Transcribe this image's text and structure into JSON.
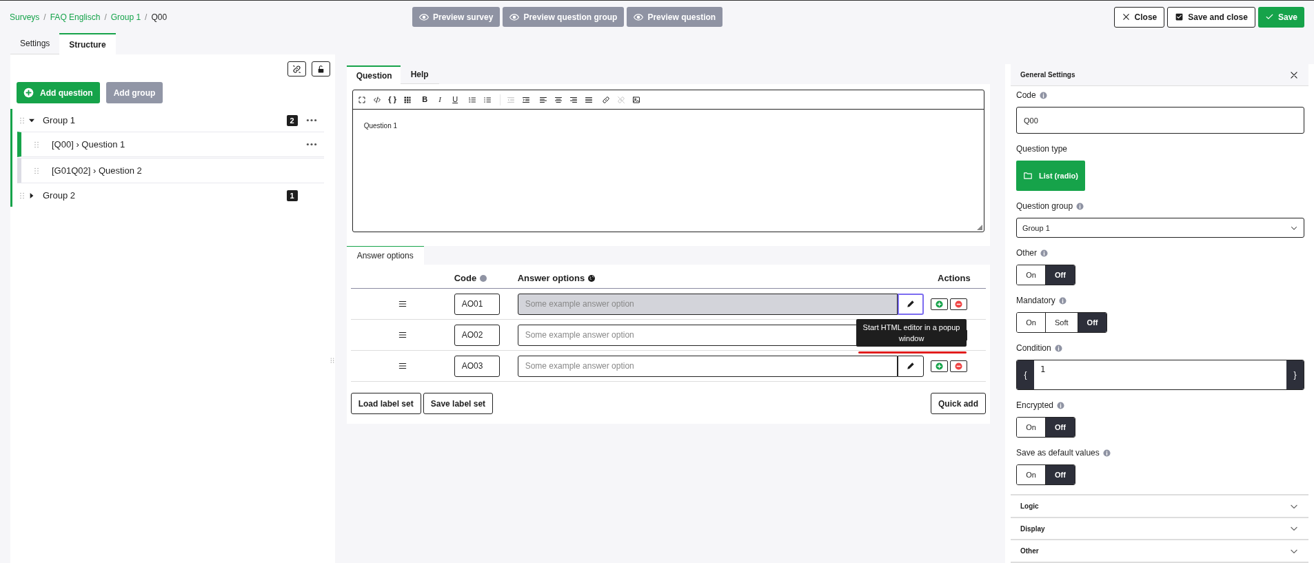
{
  "breadcrumbs": {
    "separator": "/",
    "items": [
      {
        "label": "Surveys",
        "kind": "link"
      },
      {
        "label": "FAQ Englisch",
        "kind": "link"
      },
      {
        "label": "Group 1",
        "kind": "link"
      },
      {
        "label": "Q00",
        "kind": "current"
      }
    ]
  },
  "preview_buttons": [
    "Preview survey",
    "Preview question group",
    "Preview question"
  ],
  "actions": [
    {
      "label": "Close",
      "kind": "close"
    },
    {
      "label": "Save and close",
      "kind": "save_close"
    },
    {
      "label": "Save",
      "kind": "save"
    }
  ],
  "page_tabs": [
    {
      "label": "Settings",
      "selected": false
    },
    {
      "label": "Structure",
      "selected": true
    }
  ],
  "structure": {
    "add_question": "Add question",
    "add_group": "Add group",
    "groups": [
      {
        "title": "Group 1",
        "count": "2",
        "expanded": true,
        "menu": true,
        "children": [
          {
            "label": "[Q00] › Question 1",
            "selected": true,
            "menu": true
          },
          {
            "label": "[G01Q02] › Question 2",
            "selected": false,
            "menu": false
          }
        ]
      },
      {
        "title": "Group 2",
        "count": "1",
        "expanded": false,
        "menu": false
      }
    ]
  },
  "editor": {
    "tabs": [
      {
        "label": "Question",
        "selected": true
      },
      {
        "label": "Help",
        "selected": false
      }
    ],
    "toolbar": [
      [
        {
          "kind": "fullscreen",
          "disabled": false
        },
        {
          "kind": "code",
          "disabled": false
        },
        {
          "kind": "braces",
          "label": "{ }",
          "disabled": false
        },
        {
          "kind": "grid",
          "disabled": false
        }
      ],
      [
        {
          "kind": "bold",
          "label": "B",
          "disabled": false
        },
        {
          "kind": "italic",
          "label": "I",
          "disabled": false
        },
        {
          "kind": "underline",
          "label": "U",
          "disabled": false
        }
      ],
      [
        {
          "kind": "ordered-list",
          "disabled": false
        },
        {
          "kind": "bullet-list",
          "disabled": false
        }
      ],
      [
        {
          "kind": "outdent",
          "disabled": true
        },
        {
          "kind": "indent",
          "disabled": false
        }
      ],
      [
        {
          "kind": "align-left",
          "disabled": false
        },
        {
          "kind": "align-center",
          "disabled": false
        },
        {
          "kind": "align-right",
          "disabled": false
        },
        {
          "kind": "justify",
          "disabled": false
        }
      ],
      [
        {
          "kind": "link",
          "disabled": false
        },
        {
          "kind": "unlink",
          "disabled": true
        },
        {
          "kind": "image",
          "disabled": false
        }
      ]
    ],
    "content": "Question 1"
  },
  "answers": {
    "tab": "Answer options",
    "columns": [
      "Code",
      "Answer options",
      "Actions"
    ],
    "rows": [
      {
        "code": "AO01",
        "placeholder": "Some example answer option",
        "active": true
      },
      {
        "code": "AO02",
        "placeholder": "Some example answer option",
        "active": false
      },
      {
        "code": "AO03",
        "placeholder": "Some example answer option",
        "active": false
      }
    ],
    "tooltip": "Start HTML editor in a popup window",
    "buttons": [
      "Load label set",
      "Save label set"
    ],
    "quick_add": "Quick add"
  },
  "settings": {
    "title": "General Settings",
    "fields": [
      {
        "kind": "text",
        "label": "Code",
        "info": true,
        "value": "Q00"
      },
      {
        "kind": "type",
        "label": "Question type",
        "info": false,
        "value": "List (radio)"
      },
      {
        "kind": "select",
        "label": "Question group",
        "info": true,
        "value": "Group 1"
      },
      {
        "kind": "toggle",
        "label": "Other",
        "info": true,
        "options": [
          {
            "label": "On",
            "selected": false
          },
          {
            "label": "Off",
            "selected": true
          }
        ]
      },
      {
        "kind": "toggle",
        "label": "Mandatory",
        "info": true,
        "options": [
          {
            "label": "On",
            "selected": false
          },
          {
            "label": "Soft",
            "selected": false
          },
          {
            "label": "Off",
            "selected": true
          }
        ]
      },
      {
        "kind": "condition",
        "label": "Condition",
        "info": true,
        "open": "{",
        "value": "1",
        "close": "}"
      },
      {
        "kind": "toggle",
        "label": "Encrypted",
        "info": true,
        "options": [
          {
            "label": "On",
            "selected": false
          },
          {
            "label": "Off",
            "selected": true
          }
        ]
      },
      {
        "kind": "toggle",
        "label": "Save as default values",
        "info": true,
        "options": [
          {
            "label": "On",
            "selected": false
          },
          {
            "label": "Off",
            "selected": true
          }
        ]
      }
    ],
    "sections": [
      "Logic",
      "Display",
      "Other"
    ]
  }
}
